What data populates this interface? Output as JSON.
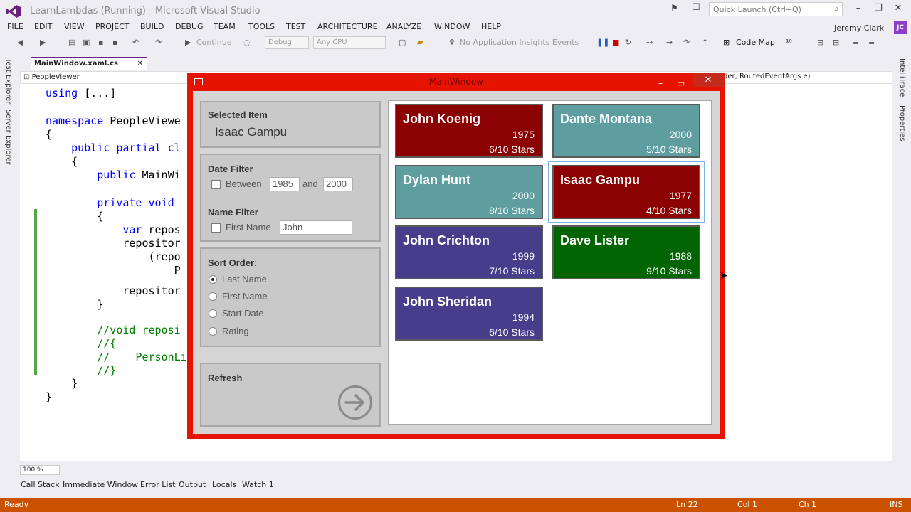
{
  "vs": {
    "title": "LearnLambdas (Running) - Microsoft Visual Studio",
    "quick_launch_placeholder": "Quick Launch (Ctrl+Q)",
    "menu": [
      "FILE",
      "EDIT",
      "VIEW",
      "PROJECT",
      "BUILD",
      "DEBUG",
      "TEAM",
      "TOOLS",
      "TEST",
      "ARCHITECTURE",
      "ANALYZE",
      "WINDOW",
      "HELP"
    ],
    "user": "Jeremy Clark",
    "user_initials": "JC",
    "toolbar": {
      "continue": "Continue",
      "config": "Debug",
      "platform": "Any CPU",
      "insights": "No Application Insights Events",
      "code_map": "Code Map"
    },
    "left_rail": [
      "Test Explorer",
      "Server Explorer"
    ],
    "right_rail": [
      "IntelliTrace",
      "Properties"
    ],
    "doc_tab": "MainWindow.xaml.cs",
    "nav_left": "PeopleViewer",
    "nav_right": "der, RoutedEventArgs e)",
    "code": [
      {
        "indent": "",
        "parts": [
          {
            "t": "using ",
            "c": "kw"
          },
          {
            "t": "[...]",
            "c": ""
          }
        ]
      },
      {
        "indent": "",
        "parts": [
          {
            "t": "namespace ",
            "c": "kw"
          },
          {
            "t": "PeopleViewe",
            "c": ""
          }
        ]
      },
      {
        "indent": "",
        "parts": [
          {
            "t": "{",
            "c": ""
          }
        ]
      },
      {
        "indent": "    ",
        "parts": [
          {
            "t": "public partial cl",
            "c": "kw"
          }
        ]
      },
      {
        "indent": "    ",
        "parts": [
          {
            "t": "{",
            "c": ""
          }
        ]
      },
      {
        "indent": "        ",
        "parts": [
          {
            "t": "public ",
            "c": "kw"
          },
          {
            "t": "MainWi",
            "c": ""
          }
        ]
      },
      {
        "indent": "        ",
        "parts": [
          {
            "t": "private void ",
            "c": "kw"
          }
        ]
      },
      {
        "indent": "        ",
        "parts": [
          {
            "t": "{",
            "c": ""
          }
        ]
      },
      {
        "indent": "            ",
        "parts": [
          {
            "t": "var ",
            "c": "kw"
          },
          {
            "t": "repos",
            "c": ""
          }
        ]
      },
      {
        "indent": "            ",
        "parts": [
          {
            "t": "repositor",
            "c": ""
          }
        ]
      },
      {
        "indent": "                ",
        "parts": [
          {
            "t": "(repo",
            "c": ""
          }
        ]
      },
      {
        "indent": "                    ",
        "parts": [
          {
            "t": "P",
            "c": ""
          }
        ]
      },
      {
        "indent": "            ",
        "parts": [
          {
            "t": "repositor",
            "c": ""
          }
        ]
      },
      {
        "indent": "        ",
        "parts": [
          {
            "t": "}",
            "c": ""
          }
        ]
      },
      {
        "indent": "        ",
        "parts": [
          {
            "t": "//void reposi",
            "c": "cm"
          }
        ]
      },
      {
        "indent": "        ",
        "parts": [
          {
            "t": "//{",
            "c": "cm"
          }
        ]
      },
      {
        "indent": "        ",
        "parts": [
          {
            "t": "//    PersonLi",
            "c": "cm"
          }
        ]
      },
      {
        "indent": "        ",
        "parts": [
          {
            "t": "//}",
            "c": "cm"
          }
        ]
      },
      {
        "indent": "    ",
        "parts": [
          {
            "t": "}",
            "c": ""
          }
        ]
      },
      {
        "indent": "",
        "parts": [
          {
            "t": "}",
            "c": ""
          }
        ]
      }
    ],
    "zoom": "100 %",
    "bottom_tabs": [
      "Call Stack",
      "Immediate Window",
      "Error List",
      "Output",
      "Locals",
      "Watch 1"
    ],
    "status": {
      "state": "Ready",
      "line": "Ln 22",
      "col": "Col 1",
      "ch": "Ch 1",
      "mode": "INS"
    }
  },
  "main_window": {
    "title": "MainWindow",
    "selected": {
      "heading": "Selected Item",
      "value": "Isaac Gampu"
    },
    "date_filter": {
      "heading": "Date Filter",
      "between_label": "Between",
      "and_label": "and",
      "from": "1985",
      "to": "2000",
      "checked": false
    },
    "name_filter": {
      "heading": "Name Filter",
      "label": "First Name",
      "value": "John",
      "checked": false
    },
    "sort": {
      "heading": "Sort Order:",
      "options": [
        "Last Name",
        "First Name",
        "Start Date",
        "Rating"
      ],
      "selected_index": 0
    },
    "refresh": {
      "label": "Refresh"
    },
    "people": [
      {
        "name": "John Koenig",
        "year": "1975",
        "stars": "6/10 Stars",
        "color": "#8b0000"
      },
      {
        "name": "Dante Montana",
        "year": "2000",
        "stars": "5/10 Stars",
        "color": "#5f9ea0"
      },
      {
        "name": "Dylan Hunt",
        "year": "2000",
        "stars": "8/10 Stars",
        "color": "#5f9ea0"
      },
      {
        "name": "Isaac Gampu",
        "year": "1977",
        "stars": "4/10 Stars",
        "color": "#8b0000",
        "selected": true
      },
      {
        "name": "John Crichton",
        "year": "1999",
        "stars": "7/10 Stars",
        "color": "#483d8b"
      },
      {
        "name": "Dave Lister",
        "year": "1988",
        "stars": "9/10 Stars",
        "color": "#006400"
      },
      {
        "name": "John Sheridan",
        "year": "1994",
        "stars": "6/10 Stars",
        "color": "#483d8b"
      }
    ]
  }
}
